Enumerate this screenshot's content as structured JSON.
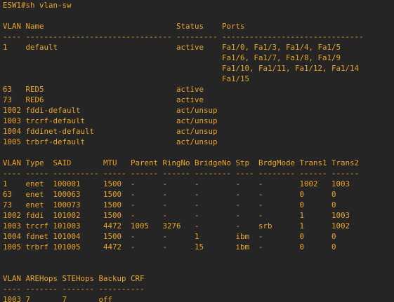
{
  "terminal": {
    "colors": {
      "background": "#252525",
      "text": "#e9a52a"
    },
    "lines": [
      "ESW1#sh vlan-sw",
      "",
      "VLAN Name                             Status    Ports",
      "---- -------------------------------- --------- -------------------------------",
      "1    default                          active    Fa1/0, Fa1/3, Fa1/4, Fa1/5",
      "                                                Fa1/6, Fa1/7, Fa1/8, Fa1/9",
      "                                                Fa1/10, Fa1/11, Fa1/12, Fa1/14",
      "                                                Fa1/15",
      "63   RED5                             active",
      "73   RED6                             active",
      "1002 fddi-default                     act/unsup",
      "1003 trcrf-default                    act/unsup",
      "1004 fddinet-default                  act/unsup",
      "1005 trbrf-default                    act/unsup",
      "",
      "VLAN Type  SAID       MTU   Parent RingNo BridgeNo Stp  BrdgMode Trans1 Trans2",
      "---- ----- ---------- ----- ------ ------ -------- ---- -------- ------ ------",
      "1    enet  100001     1500  -      -      -        -    -        1002   1003",
      "63   enet  100063     1500  -      -      -        -    -        0      0",
      "73   enet  100073     1500  -      -      -        -    -        0      0",
      "1002 fddi  101002     1500  -      -      -        -    -        1      1003",
      "1003 trcrf 101003     4472  1005   3276   -        -    srb      1      1002",
      "1004 fdnet 101004     1500  -      -      1        ibm  -        0      0",
      "1005 trbrf 101005     4472  -      -      15       ibm  -        0      0",
      "",
      "",
      "VLAN AREHops STEHops Backup CRF",
      "---- ------- ------- ----------",
      "1003 7       7       off"
    ]
  }
}
